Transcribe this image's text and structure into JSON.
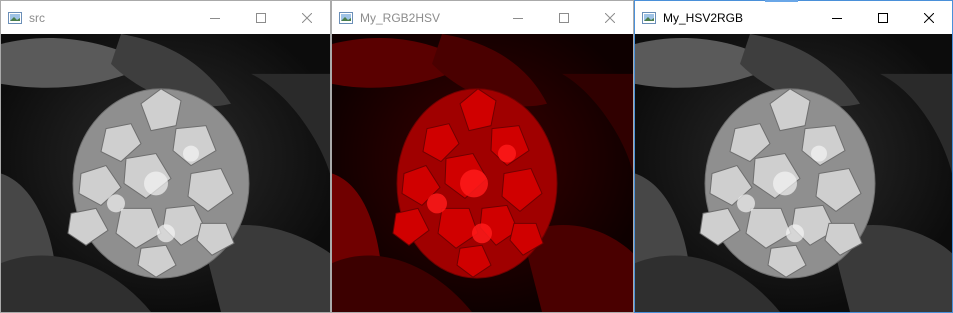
{
  "windows": [
    {
      "id": "src",
      "title": "src",
      "active": false,
      "image": {
        "tint": "grayscale",
        "subject": "hydrangea flower with leaves"
      }
    },
    {
      "id": "hsv",
      "title": "My_RGB2HSV",
      "active": false,
      "image": {
        "tint": "red",
        "subject": "hydrangea flower with leaves"
      }
    },
    {
      "id": "rgb",
      "title": "My_HSV2RGB",
      "active": true,
      "image": {
        "tint": "grayscale",
        "subject": "hydrangea flower with leaves"
      }
    }
  ],
  "caption_buttons": {
    "minimize_icon": "minimize-icon",
    "maximize_icon": "maximize-icon",
    "close_icon": "close-icon"
  },
  "colors": {
    "active_border": "#4a90d9",
    "inactive_border": "#aaaaaa",
    "inactive_title_text": "#8c8c8c",
    "active_title_text": "#000000",
    "gray_highlight": "#f4f4f4",
    "red_highlight": "#ff1a1a"
  }
}
